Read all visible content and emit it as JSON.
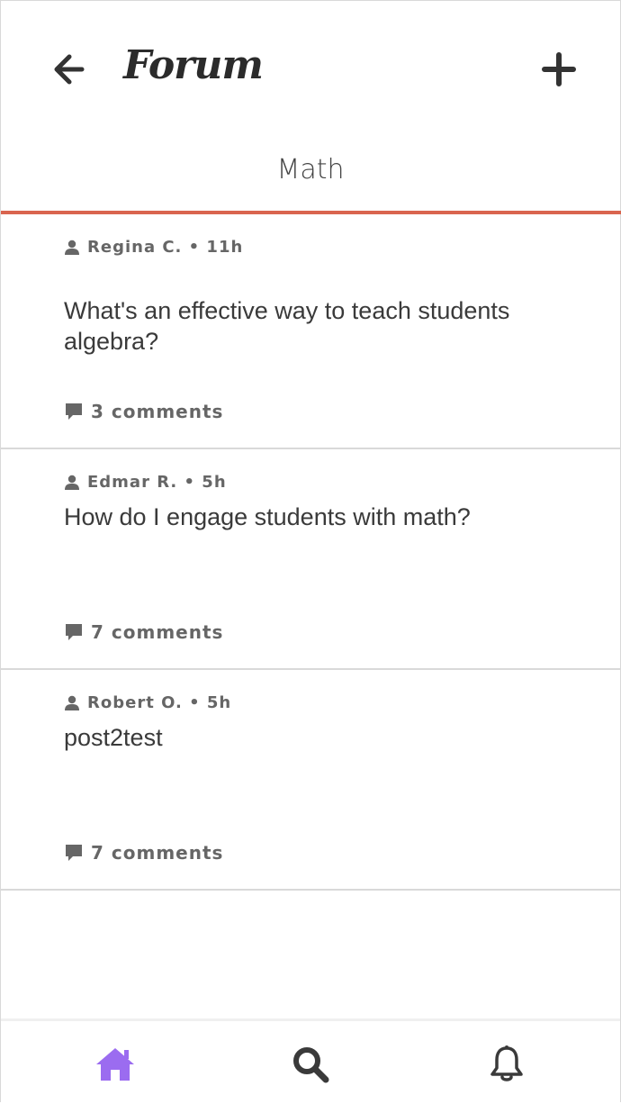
{
  "header": {
    "title": "Forum",
    "back_icon": "arrow-left-icon",
    "add_icon": "plus-icon"
  },
  "category": {
    "name": "Math",
    "accent_color": "#d9654f"
  },
  "posts": [
    {
      "author": "Regina C.",
      "time": "11h",
      "meta": "Regina C. • 11h",
      "title": "What's an effective way to teach students algebra?",
      "comments": "3 comments"
    },
    {
      "author": "Edmar R.",
      "time": "5h",
      "meta": "Edmar R. • 5h",
      "title": "How do I engage students with math?",
      "comments": "7 comments"
    },
    {
      "author": "Robert O.",
      "time": "5h",
      "meta": "Robert O. • 5h",
      "title": "post2test",
      "comments": "7 comments"
    }
  ],
  "tabbar": {
    "items": [
      {
        "name": "home",
        "icon": "home-icon",
        "active": true,
        "color": "#9b6cf0"
      },
      {
        "name": "search",
        "icon": "search-icon",
        "active": false,
        "color": "#3a3a3a"
      },
      {
        "name": "notifications",
        "icon": "bell-icon",
        "active": false,
        "color": "#3a3a3a"
      }
    ]
  }
}
